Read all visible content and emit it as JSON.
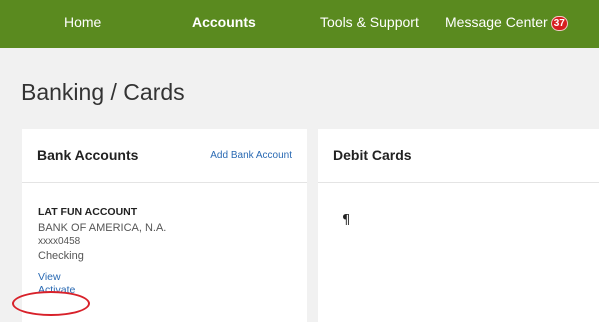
{
  "nav": {
    "items": [
      {
        "label": "Home"
      },
      {
        "label": "Accounts"
      },
      {
        "label": "Tools & Support"
      },
      {
        "label": "Message Center"
      }
    ],
    "message_count": "37",
    "colors": {
      "bar": "#5a8a1f",
      "badge": "#d61f1f"
    }
  },
  "page": {
    "title": "Banking / Cards"
  },
  "bank_panel": {
    "title": "Bank Accounts",
    "add_link": "Add Bank Account",
    "account": {
      "name": "LAT FUN ACCOUNT",
      "bank": "BANK OF AMERICA, N.A.",
      "number": "xxxx0458",
      "type": "Checking",
      "view_link": "View",
      "activate_link": "Activate"
    }
  },
  "debit_panel": {
    "title": "Debit Cards",
    "placeholder_mark": "¶"
  },
  "annotation": {
    "color": "#d8212a",
    "target": "Activate"
  }
}
